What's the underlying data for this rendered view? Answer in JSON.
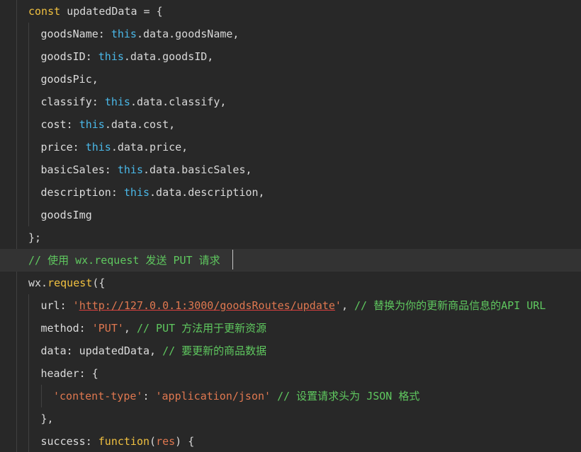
{
  "colors": {
    "background": "#282828",
    "current_line": "#333333",
    "keyword": "#f0c040",
    "this": "#4ab8e8",
    "string": "#e07850",
    "comment": "#5fc85f",
    "text": "#d8d8d8"
  },
  "lines": [
    {
      "indent": 0,
      "tokens": [
        {
          "t": "const ",
          "c": "kw"
        },
        {
          "t": "updatedData = {",
          "c": "punc"
        }
      ]
    },
    {
      "indent": 1,
      "tokens": [
        {
          "t": "goodsName: ",
          "c": "key"
        },
        {
          "t": "this",
          "c": "this"
        },
        {
          "t": ".data.goodsName,",
          "c": "prop"
        }
      ]
    },
    {
      "indent": 1,
      "tokens": [
        {
          "t": "goodsID: ",
          "c": "key"
        },
        {
          "t": "this",
          "c": "this"
        },
        {
          "t": ".data.goodsID,",
          "c": "prop"
        }
      ]
    },
    {
      "indent": 1,
      "tokens": [
        {
          "t": "goodsPic,",
          "c": "key"
        }
      ]
    },
    {
      "indent": 1,
      "tokens": [
        {
          "t": "classify: ",
          "c": "key"
        },
        {
          "t": "this",
          "c": "this"
        },
        {
          "t": ".data.classify,",
          "c": "prop"
        }
      ]
    },
    {
      "indent": 1,
      "tokens": [
        {
          "t": "cost: ",
          "c": "key"
        },
        {
          "t": "this",
          "c": "this"
        },
        {
          "t": ".data.cost,",
          "c": "prop"
        }
      ]
    },
    {
      "indent": 1,
      "tokens": [
        {
          "t": "price: ",
          "c": "key"
        },
        {
          "t": "this",
          "c": "this"
        },
        {
          "t": ".data.price,",
          "c": "prop"
        }
      ]
    },
    {
      "indent": 1,
      "tokens": [
        {
          "t": "basicSales: ",
          "c": "key"
        },
        {
          "t": "this",
          "c": "this"
        },
        {
          "t": ".data.basicSales,",
          "c": "prop"
        }
      ]
    },
    {
      "indent": 1,
      "tokens": [
        {
          "t": "description: ",
          "c": "key"
        },
        {
          "t": "this",
          "c": "this"
        },
        {
          "t": ".data.description,",
          "c": "prop"
        }
      ]
    },
    {
      "indent": 1,
      "tokens": [
        {
          "t": "goodsImg",
          "c": "key"
        }
      ]
    },
    {
      "indent": 0,
      "tokens": [
        {
          "t": "};",
          "c": "punc"
        }
      ]
    },
    {
      "indent": 0,
      "current": true,
      "tokens": [
        {
          "t": "// 使用 wx.request 发送 PUT 请求 ",
          "c": "cmt"
        }
      ]
    },
    {
      "indent": 0,
      "tokens": [
        {
          "t": "wx.",
          "c": "punc"
        },
        {
          "t": "request",
          "c": "fn"
        },
        {
          "t": "({",
          "c": "punc"
        }
      ]
    },
    {
      "indent": 1,
      "tokens": [
        {
          "t": "url: ",
          "c": "key"
        },
        {
          "t": "'",
          "c": "str"
        },
        {
          "t": "http://127.0.0.1:3000/goodsRoutes/update",
          "c": "url"
        },
        {
          "t": "'",
          "c": "str"
        },
        {
          "t": ", ",
          "c": "punc"
        },
        {
          "t": "// 替换为你的更新商品信息的API URL",
          "c": "cmt"
        }
      ]
    },
    {
      "indent": 1,
      "tokens": [
        {
          "t": "method: ",
          "c": "key"
        },
        {
          "t": "'PUT'",
          "c": "str"
        },
        {
          "t": ", ",
          "c": "punc"
        },
        {
          "t": "// PUT 方法用于更新资源",
          "c": "cmt"
        }
      ]
    },
    {
      "indent": 1,
      "tokens": [
        {
          "t": "data: updatedData, ",
          "c": "key"
        },
        {
          "t": "// 要更新的商品数据",
          "c": "cmt"
        }
      ]
    },
    {
      "indent": 1,
      "tokens": [
        {
          "t": "header: {",
          "c": "key"
        }
      ]
    },
    {
      "indent": 2,
      "tokens": [
        {
          "t": "'content-type'",
          "c": "str"
        },
        {
          "t": ": ",
          "c": "punc"
        },
        {
          "t": "'application/json'",
          "c": "str"
        },
        {
          "t": " ",
          "c": "punc"
        },
        {
          "t": "// 设置请求头为 JSON 格式",
          "c": "cmt"
        }
      ]
    },
    {
      "indent": 1,
      "tokens": [
        {
          "t": "},",
          "c": "punc"
        }
      ]
    },
    {
      "indent": 1,
      "tokens": [
        {
          "t": "success: ",
          "c": "key"
        },
        {
          "t": "function",
          "c": "kw"
        },
        {
          "t": "(",
          "c": "punc"
        },
        {
          "t": "res",
          "c": "param"
        },
        {
          "t": ") {",
          "c": "punc"
        }
      ]
    }
  ]
}
